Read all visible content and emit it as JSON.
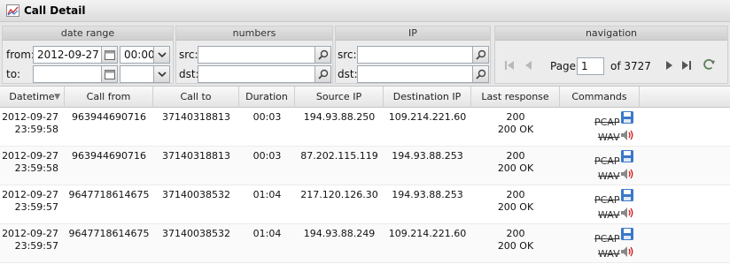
{
  "window": {
    "title": "Call Detail"
  },
  "filters": {
    "date_range": {
      "header": "date range",
      "from_label": "from:",
      "to_label": "to:",
      "from_date": "2012-09-27",
      "from_time": "00:00",
      "to_date": "",
      "to_time": ""
    },
    "numbers": {
      "header": "numbers",
      "src_label": "src:",
      "dst_label": "dst:",
      "src_value": "",
      "dst_value": ""
    },
    "ip": {
      "header": "IP",
      "src_label": "src:",
      "dst_label": "dst:",
      "src_value": "",
      "dst_value": ""
    },
    "navigation": {
      "header": "navigation",
      "page_label": "Page",
      "page_value": "1",
      "of_label": "of 3727"
    }
  },
  "grid": {
    "columns": [
      "Datetime",
      "Call from",
      "Call to",
      "Duration",
      "Source IP",
      "Destination IP",
      "Last response",
      "Commands"
    ],
    "rows": [
      {
        "date": "2012-09-27",
        "time": "23:59:58",
        "call_from": "963944690716",
        "call_to": "37140318813",
        "duration": "00:03",
        "source_ip": "194.93.88.250",
        "destination_ip": "109.214.221.60",
        "response_code": "200",
        "response_text": "200 OK",
        "pcap": "PCAP",
        "wav": "WAV"
      },
      {
        "date": "2012-09-27",
        "time": "23:59:58",
        "call_from": "963944690716",
        "call_to": "37140318813",
        "duration": "00:03",
        "source_ip": "87.202.115.119",
        "destination_ip": "194.93.88.253",
        "response_code": "200",
        "response_text": "200 OK",
        "pcap": "PCAP",
        "wav": "WAV"
      },
      {
        "date": "2012-09-27",
        "time": "23:59:57",
        "call_from": "9647718614675",
        "call_to": "37140038532",
        "duration": "01:04",
        "source_ip": "217.120.126.30",
        "destination_ip": "194.93.88.253",
        "response_code": "200",
        "response_text": "200 OK",
        "pcap": "PCAP",
        "wav": "WAV"
      },
      {
        "date": "2012-09-27",
        "time": "23:59:57",
        "call_from": "9647718614675",
        "call_to": "37140038532",
        "duration": "01:04",
        "source_ip": "194.93.88.249",
        "destination_ip": "109.214.221.60",
        "response_code": "200",
        "response_text": "200 OK",
        "pcap": "PCAP",
        "wav": "WAV"
      }
    ]
  },
  "colors": {
    "save_icon": "#3a78c9",
    "speaker_icon": "#888888",
    "sound_waves": "#d42020"
  },
  "icons": [
    "chart-icon",
    "calendar-icon",
    "chevron-down-icon",
    "search-icon",
    "first-page-icon",
    "prev-page-icon",
    "next-page-icon",
    "last-page-icon",
    "refresh-icon",
    "sort-arrow-icon",
    "save-icon",
    "speaker-icon"
  ]
}
